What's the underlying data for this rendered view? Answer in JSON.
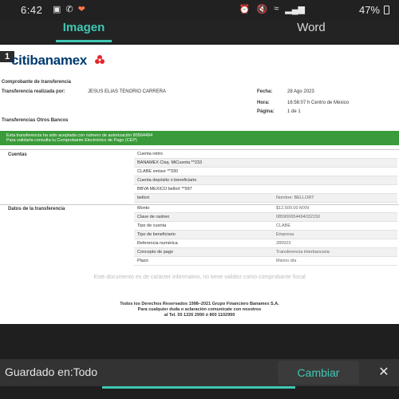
{
  "status_bar": {
    "time": "6:42",
    "battery": "47%",
    "left_icons": [
      "screen-record-icon",
      "phone-icon",
      "app-notification-icon"
    ],
    "right_icons": [
      "alarm-icon",
      "mute-icon",
      "wifi-icon",
      "signal-icon"
    ]
  },
  "tabs": [
    {
      "label": "Imagen",
      "active": true
    },
    {
      "label": "Word",
      "active": false
    }
  ],
  "document": {
    "page_number": "1",
    "logo_text": "citibanamex",
    "title": "Comprobante de transferencia",
    "made_by_label": "Transferencia realizada por:",
    "made_by_value": "JESUS ELIAS TENORIO CARRERA",
    "date_label": "Fecha:",
    "date_value": "28 Ago 2023",
    "hour_label": "Hora:",
    "hour_value": "16:56:07 h Centro de México",
    "page_label": "Página:",
    "page_value": "1 de 1",
    "section_title": "Transferencias Otros Bancos",
    "green_line1": "Esta transferencia ha sido aceptada con número de autorización 80564494",
    "green_line2": "Para validarla consulta tu Comprobante Electrónico de Pago (CEP)",
    "accounts_label": "Cuentas",
    "accounts_rows": [
      {
        "k": "Cuenta retiro",
        "v": ""
      },
      {
        "k": "BANAMEX Clsq. MiCuenta **233",
        "v": ""
      },
      {
        "k": "CLABE emisor **330",
        "v": ""
      },
      {
        "k": "Cuenta depósito o beneficiario",
        "v": ""
      },
      {
        "k": "BBVA MEXICO bellort **997",
        "v": ""
      },
      {
        "k": "bellort",
        "v": "Nombre: BELLORT"
      }
    ],
    "details_label": "Datos de la transferencia",
    "details_rows": [
      {
        "k": "Monto",
        "v": "$12,500.00 MXN"
      },
      {
        "k": "Clave de rastreo",
        "v": "085900654494032150"
      },
      {
        "k": "Tipo de cuenta",
        "v": "CLABE"
      },
      {
        "k": "Tipo de beneficiario",
        "v": "Empresa"
      },
      {
        "k": "Referencia numérica",
        "v": "280923"
      },
      {
        "k": "Concepto de pago",
        "v": "Transferencia interbancaria"
      },
      {
        "k": "Plazo",
        "v": "Mismo día"
      }
    ],
    "disclaimer": "Este documento es de carácter informativo, no tiene validez como comprobante fiscal",
    "footer_line1": "Todos los Derechos Reservados 1998–2021 Grupo Financiero Banamex S.A.",
    "footer_line2": "Para cualquier duda o aclaración comunícate con nosotros",
    "footer_line3": "al Tel. 55 1226 2990 ó 800 1102990"
  },
  "bottom_bar": {
    "saved_text": "Guardado en:Todo",
    "change_label": "Cambiar",
    "close_icon": "✕"
  },
  "colors": {
    "accent": "#3ec8b4",
    "green_bar": "#3a9b3a",
    "logo_blue": "#003b71",
    "logo_red": "#e3262d"
  }
}
